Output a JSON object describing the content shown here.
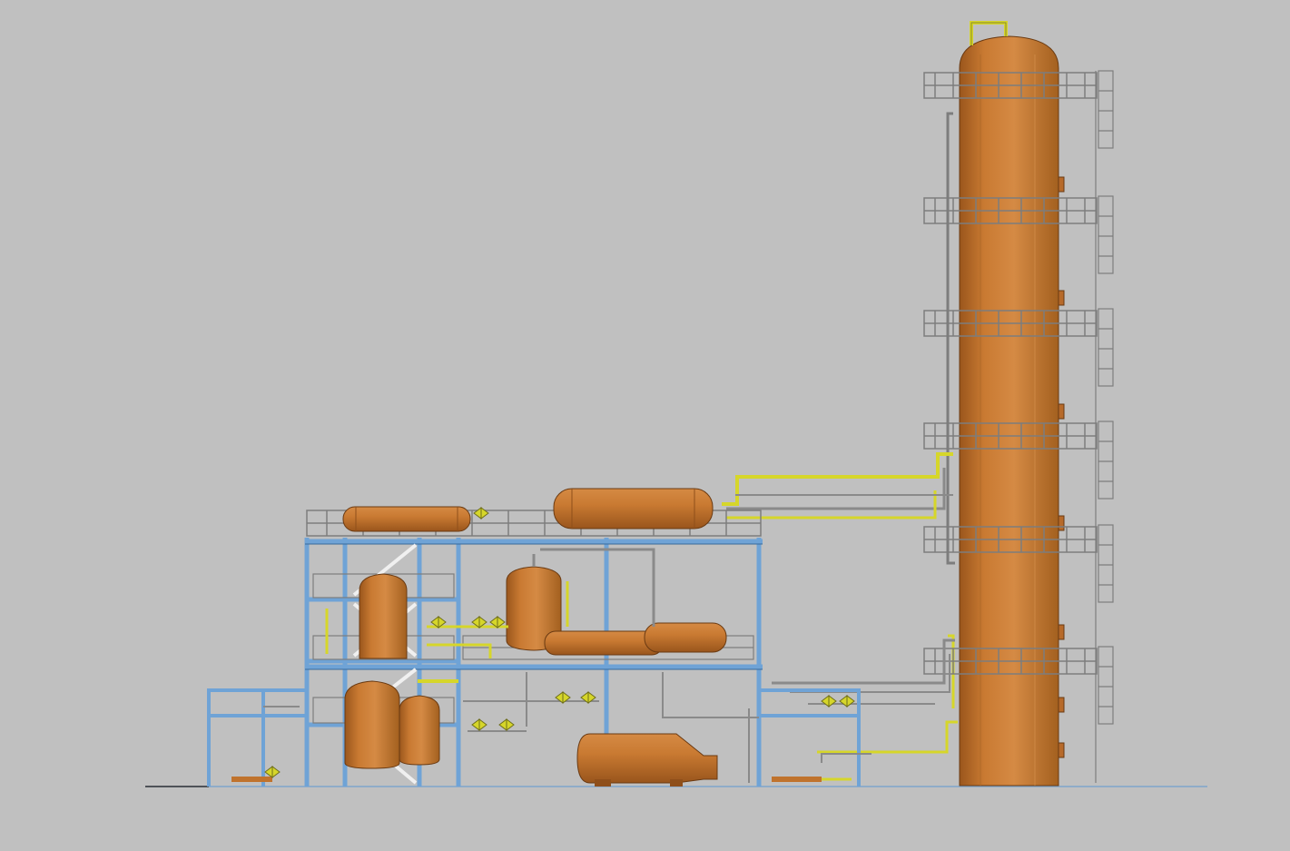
{
  "scene": {
    "kind": "3D plant model elevation view",
    "background_color": "#c0c0c0",
    "colors": {
      "vessel": "#c0732d",
      "vessel_highlight": "#d98c45",
      "vessel_shadow": "#8f4f1a",
      "steel_frame": "#6fa3d6",
      "handrail": "#7d7d7d",
      "pipe_grey": "#8a8a8a",
      "pipe_yellow": "#d6d62a",
      "bracing": "#f0f0f0",
      "ground_line": "#7fa6cc"
    },
    "equipment": [
      {
        "name": "distillation-column",
        "icon": "tall-column-icon"
      },
      {
        "name": "top-horizontal-drum-right",
        "icon": "horizontal-drum-icon"
      },
      {
        "name": "top-horizontal-drum-left",
        "icon": "horizontal-drum-icon"
      },
      {
        "name": "vertical-drum-center",
        "icon": "vertical-drum-icon"
      },
      {
        "name": "horizontal-drum-mid",
        "icon": "horizontal-drum-icon"
      },
      {
        "name": "horizontal-drum-small",
        "icon": "horizontal-drum-icon"
      },
      {
        "name": "ground-horizontal-drum",
        "icon": "horizontal-drum-icon"
      },
      {
        "name": "vertical-vessels-left-group",
        "icon": "vertical-drum-icon"
      }
    ],
    "structures": [
      {
        "name": "main-pipe-rack",
        "icon": "steel-structure-icon"
      },
      {
        "name": "left-pipe-support",
        "icon": "steel-structure-icon"
      },
      {
        "name": "right-pipe-support",
        "icon": "steel-structure-icon"
      },
      {
        "name": "column-platforms",
        "icon": "platform-icon",
        "count": 6
      },
      {
        "name": "column-ladder",
        "icon": "ladder-icon"
      },
      {
        "name": "stair-bracing",
        "icon": "stair-icon"
      }
    ]
  }
}
